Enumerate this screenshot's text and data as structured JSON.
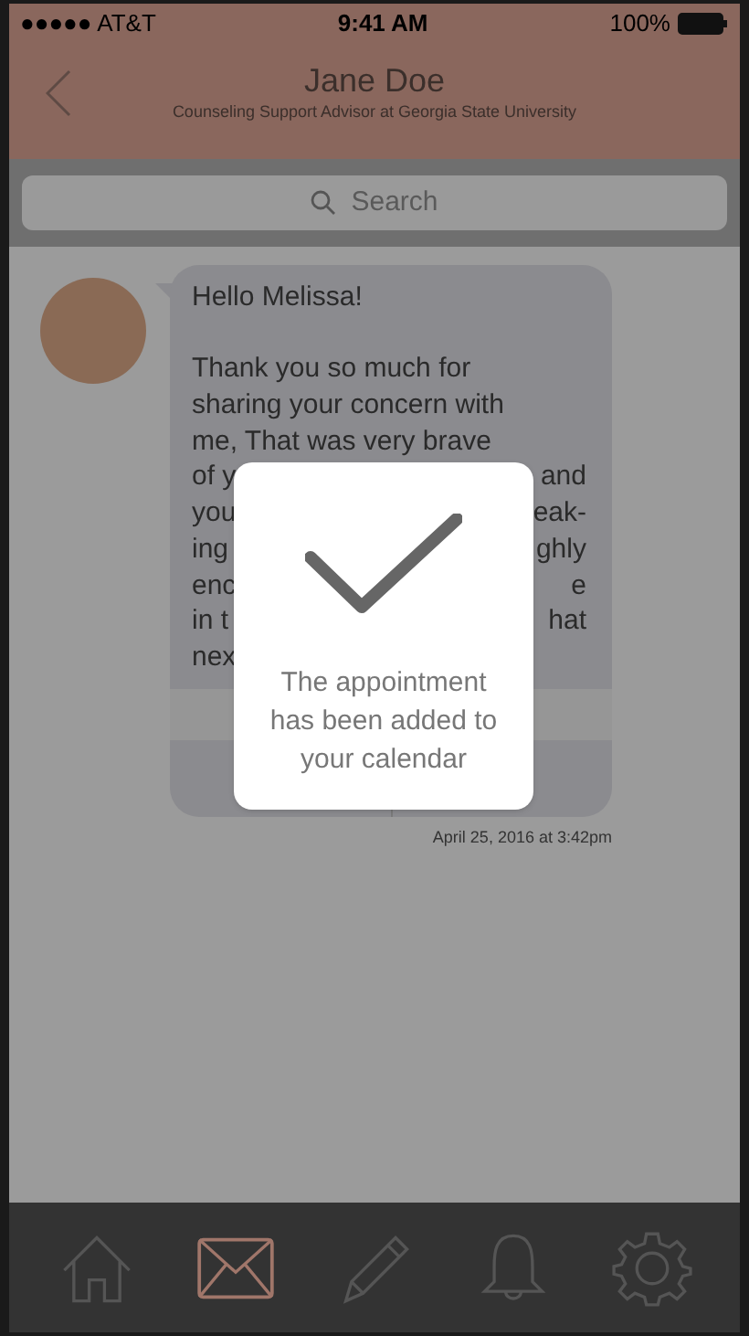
{
  "status_bar": {
    "carrier": "●●●●● AT&T",
    "time": "9:41 AM",
    "battery": "100%"
  },
  "header": {
    "title": "Jane Doe",
    "subtitle": "Counseling Support Advisor at Georgia State University"
  },
  "search": {
    "placeholder": "Search"
  },
  "message": {
    "greeting": "Hello Melissa!",
    "lines": [
      {
        "left": "Thank you so much for"
      },
      {
        "left": "sharing your concern with"
      },
      {
        "left": "me, That was very brave"
      },
      {
        "left": "of y",
        "right": "and"
      },
      {
        "left": "you",
        "right": "eak-"
      },
      {
        "left": "ing",
        "right": "ghly"
      },
      {
        "left": "enc",
        "right": "e"
      },
      {
        "left": "in t",
        "right": "hat"
      },
      {
        "left": "nex"
      }
    ],
    "timestamp": "April 25, 2016 at 3:42pm"
  },
  "dialog": {
    "text": "The appointment has been added to your calendar"
  },
  "tab_bar": [
    {
      "selected": false
    },
    {
      "selected": true
    },
    {
      "selected": false
    },
    {
      "selected": false
    },
    {
      "selected": false
    }
  ]
}
